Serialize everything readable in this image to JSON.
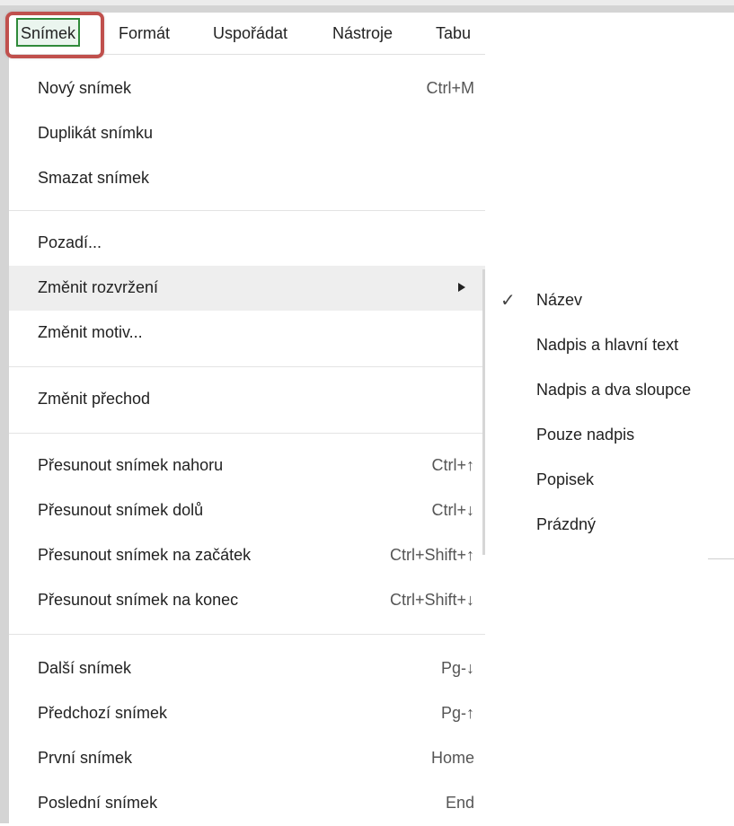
{
  "menubar": {
    "items": [
      {
        "label": "Snímek",
        "active": true
      },
      {
        "label": "Formát"
      },
      {
        "label": "Uspořádat"
      },
      {
        "label": "Nástroje"
      },
      {
        "label": "Tabu"
      }
    ]
  },
  "menu": {
    "items": [
      {
        "label": "Nový snímek",
        "shortcut": "Ctrl+M"
      },
      {
        "label": "Duplikát snímku",
        "shortcut": ""
      },
      {
        "label": "Smazat snímek",
        "shortcut": ""
      },
      {
        "label": "Pozadí...",
        "shortcut": ""
      },
      {
        "label": "Změnit rozvržení",
        "shortcut": "",
        "submenu": true,
        "highlighted": true
      },
      {
        "label": "Změnit motiv...",
        "shortcut": ""
      },
      {
        "label": "Změnit přechod",
        "shortcut": ""
      },
      {
        "label": "Přesunout snímek nahoru",
        "shortcut": "Ctrl+↑"
      },
      {
        "label": "Přesunout snímek dolů",
        "shortcut": "Ctrl+↓"
      },
      {
        "label": "Přesunout snímek na začátek",
        "shortcut": "Ctrl+Shift+↑"
      },
      {
        "label": "Přesunout snímek na konec",
        "shortcut": "Ctrl+Shift+↓"
      },
      {
        "label": "Další snímek",
        "shortcut": "Pg-↓"
      },
      {
        "label": "Předchozí snímek",
        "shortcut": "Pg-↑"
      },
      {
        "label": "První snímek",
        "shortcut": "Home"
      },
      {
        "label": "Poslední snímek",
        "shortcut": "End"
      }
    ]
  },
  "submenu": {
    "items": [
      {
        "label": "Název",
        "checked": true
      },
      {
        "label": "Nadpis a hlavní text"
      },
      {
        "label": "Nadpis a dva sloupce"
      },
      {
        "label": "Pouze nadpis"
      },
      {
        "label": "Popisek"
      },
      {
        "label": "Prázdný"
      }
    ],
    "check_glyph": "✓"
  },
  "colors": {
    "active_border": "#2f8a3a",
    "active_fill": "#eaf5ee",
    "callout_ring": "#c0504d",
    "hover": "#eeeeee"
  }
}
